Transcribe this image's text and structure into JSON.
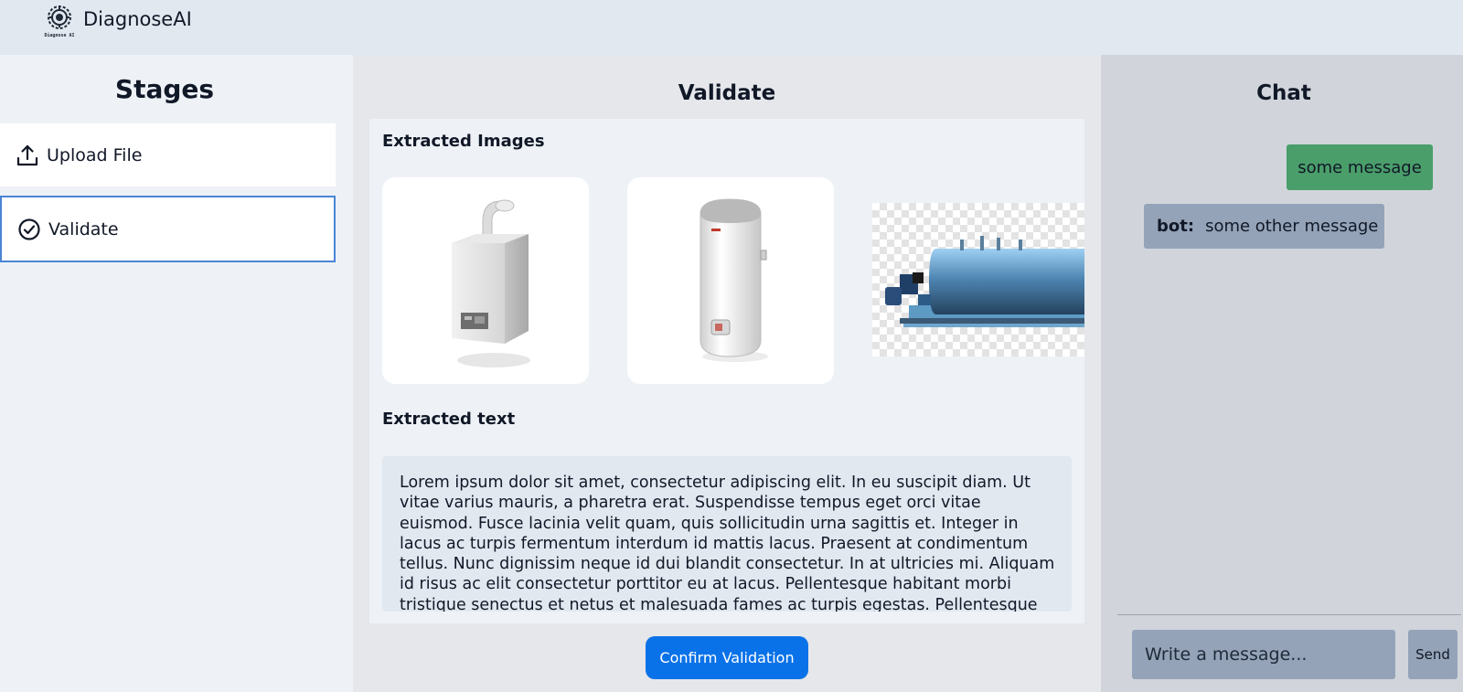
{
  "app": {
    "name": "DiagnoseAI",
    "logo_text": "Diagnose AI",
    "logo_icon": "gear-circuit-logo"
  },
  "stages": {
    "title": "Stages",
    "items": [
      {
        "label": "Upload File",
        "icon": "upload-icon",
        "active": false
      },
      {
        "label": "Validate",
        "icon": "check-circle-icon",
        "active": true
      }
    ]
  },
  "validate": {
    "title": "Validate",
    "images_title": "Extracted Images",
    "images": [
      {
        "subject": "wall-mounted gas boiler"
      },
      {
        "subject": "electric water heater"
      },
      {
        "subject": "industrial steam boiler"
      }
    ],
    "text_title": "Extracted text",
    "extracted_text": "Lorem ipsum dolor sit amet, consectetur adipiscing elit. In eu suscipit diam. Ut vitae varius mauris, a pharetra erat. Suspendisse tempus eget orci vitae euismod. Fusce lacinia velit quam, quis sollicitudin urna sagittis et. Integer in lacus ac turpis fermentum interdum id mattis lacus. Praesent at condimentum tellus. Nunc dignissim neque id dui blandit consectetur. In at ultricies mi. Aliquam id risus ac elit consectetur porttitor eu at lacus. Pellentesque habitant morbi tristique senectus et netus et malesuada fames ac turpis egestas. Pellentesque aliquam",
    "confirm_label": "Confirm Validation"
  },
  "chat": {
    "title": "Chat",
    "messages": [
      {
        "from": "user",
        "sender": "",
        "text": "some message"
      },
      {
        "from": "bot",
        "sender": "bot:",
        "text": "some other message"
      }
    ],
    "input_placeholder": "Write a message...",
    "send_label": "Send"
  },
  "colors": {
    "accent": "#0a72e8",
    "active_border": "#4a84d4",
    "user_bubble": "#4a9e6a",
    "bot_bubble": "#94a3b8"
  }
}
